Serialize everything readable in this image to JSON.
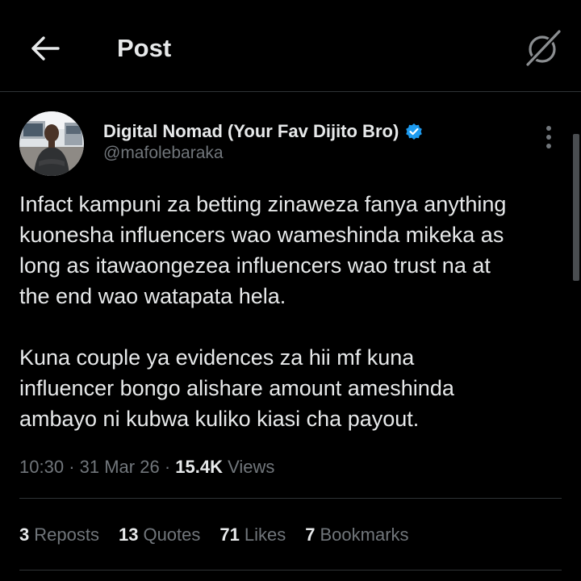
{
  "header": {
    "back_icon": "arrow-left-icon",
    "title": "Post",
    "grok_icon": "grok-icon"
  },
  "author": {
    "name": "Digital Nomad (Your Fav Dijito Bro)",
    "handle": "@mafolebaraka",
    "verified": true,
    "verified_color": "#1d9bf0"
  },
  "tweet": {
    "paragraph1": [
      "Infact kampuni za betting zinaweza fanya anything",
      "kuonesha influencers wao wameshinda mikeka as",
      "long as itawaongezea influencers wao trust na at",
      "the end wao watapata hela."
    ],
    "paragraph2": [
      "Kuna couple ya evidences za hii mf kuna",
      "influencer bongo alishare amount ameshinda",
      "ambayo ni kubwa kuliko kiasi cha payout."
    ]
  },
  "meta": {
    "time": "10:30",
    "date": "31 Mar 26",
    "views_count": "15.4K",
    "views_label": "Views",
    "separator": "·"
  },
  "stats": {
    "reposts_count": "3",
    "reposts_label": "Reposts",
    "quotes_count": "13",
    "quotes_label": "Quotes",
    "likes_count": "71",
    "likes_label": "Likes",
    "bookmarks_count": "7",
    "bookmarks_label": "Bookmarks"
  },
  "colors": {
    "background": "#000000",
    "text_primary": "#e7e9ea",
    "text_secondary": "#71767b",
    "divider": "#2f3336",
    "accent": "#1d9bf0"
  }
}
